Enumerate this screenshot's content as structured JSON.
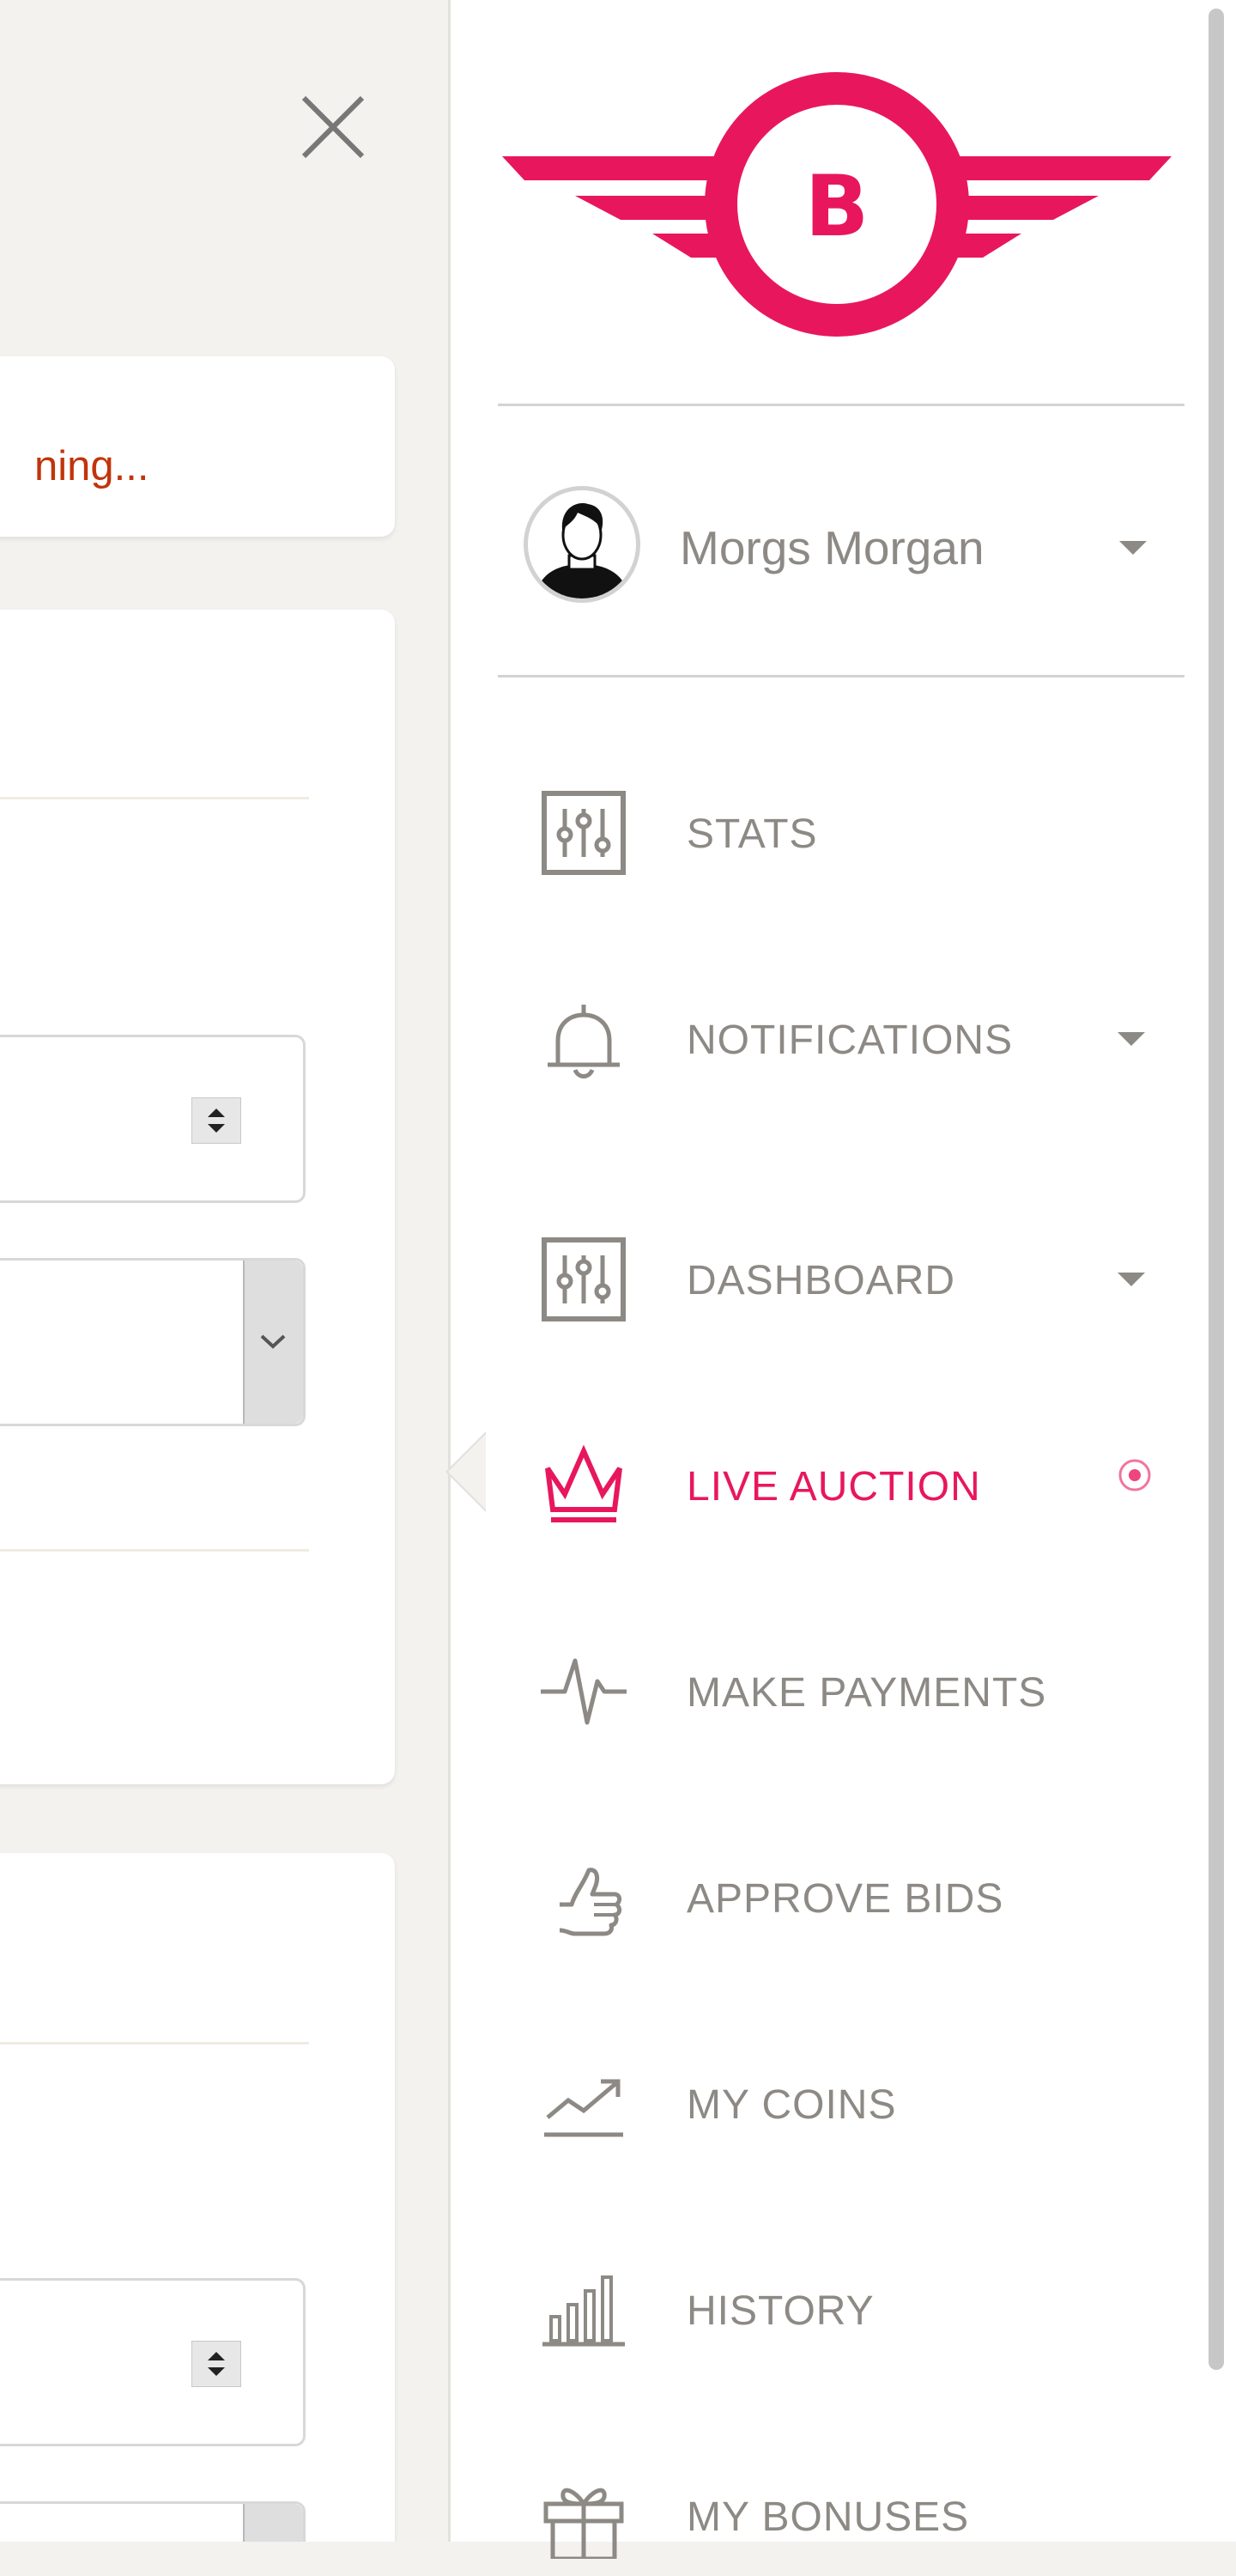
{
  "content": {
    "status_text": "ning..."
  },
  "logo": {
    "letter": "B",
    "color": "#e8175d"
  },
  "user": {
    "name": "Morgs Morgan"
  },
  "menu": {
    "items": [
      {
        "label": "STATS",
        "icon": "sliders-icon"
      },
      {
        "label": "NOTIFICATIONS",
        "icon": "bell-icon"
      },
      {
        "label": "DASHBOARD",
        "icon": "sliders-icon"
      },
      {
        "label": "LIVE AUCTION",
        "icon": "crown-icon",
        "active": true
      },
      {
        "label": "MAKE PAYMENTS",
        "icon": "pulse-icon"
      },
      {
        "label": "APPROVE BIDS",
        "icon": "thumbs-up-icon"
      },
      {
        "label": "MY COINS",
        "icon": "trend-up-icon"
      },
      {
        "label": "HISTORY",
        "icon": "bar-chart-icon"
      },
      {
        "label": "MY BONUSES",
        "icon": "gift-icon"
      }
    ]
  },
  "colors": {
    "accent": "#e8175d",
    "muted": "#8d8984",
    "status": "#c1340b"
  }
}
